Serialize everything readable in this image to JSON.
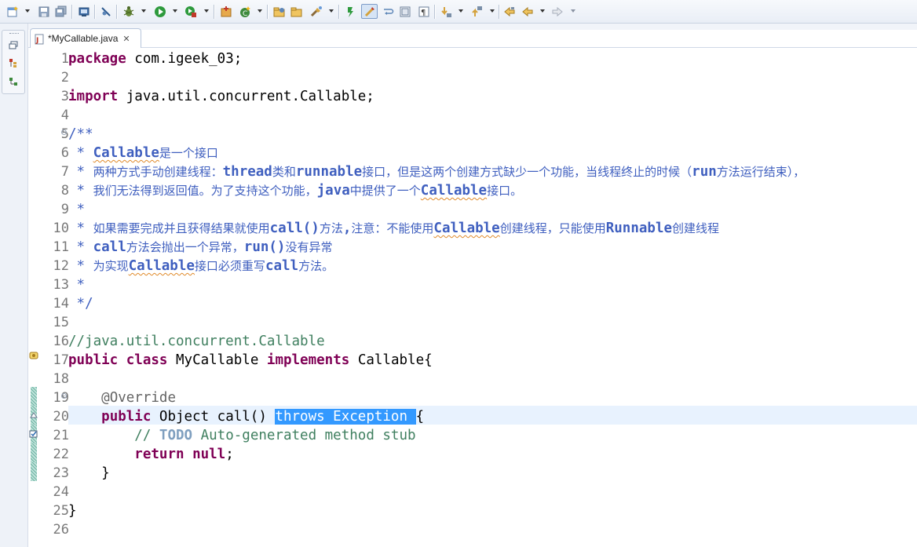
{
  "toolbar": {
    "icons": [
      "new-wizard-icon",
      "save-icon",
      "save-all-icon",
      "print-icon",
      "skip-breakpoints-icon",
      "debug-icon",
      "run-icon",
      "external-tools-icon",
      "new-java-project-icon",
      "new-java-class-icon",
      "open-type-icon",
      "open-task-icon",
      "search-icon",
      "toggle-mark-occurrences-icon",
      "toggle-block-selection-icon",
      "word-wrap-icon",
      "show-whitespace-icon",
      "next-annotation-icon",
      "previous-annotation-icon",
      "last-edit-location-icon",
      "back-icon",
      "forward-icon"
    ]
  },
  "editor_tab": {
    "label": "*MyCallable.java",
    "close_glyph": "✕"
  },
  "code": {
    "line_numbers": [
      "1",
      "2",
      "3",
      "4",
      "5",
      "6",
      "7",
      "8",
      "9",
      "10",
      "11",
      "12",
      "13",
      "14",
      "15",
      "16",
      "17",
      "18",
      "19",
      "20",
      "21",
      "22",
      "23",
      "24",
      "25",
      "26"
    ],
    "l1_kw": "package",
    "l1_rest": " com.igeek_03;",
    "l3_kw": "import",
    "l3_rest": " java.util.concurrent.Callable;",
    "l5": "/**",
    "l6_star": " * ",
    "l6_word": "Callable",
    "l6_cn": "是一个接口",
    "l7_star": " * ",
    "l7_cn1": "两种方式手动创建线程：",
    "l7_w1": "thread",
    "l7_cn2": "类和",
    "l7_w2": "runnable",
    "l7_cn3": "接口，但是这两个创建方式缺少一个功能，当线程终止的时候（",
    "l7_w3": "run",
    "l7_cn4": "方法运行结束），",
    "l8_star": " * ",
    "l8_cn1": "我们无法得到返回值。为了支持这个功能，",
    "l8_w1": "java",
    "l8_cn2": "中提供了一个",
    "l8_w2": "Callable",
    "l8_cn3": "接口。",
    "l9": " *",
    "l10_star": " * ",
    "l10_cn1": "如果需要完成并且获得结果就使用",
    "l10_w1": "call()",
    "l10_cn2": "方法",
    "l10_w2": ",",
    "l10_cn3": "注意：不能使用",
    "l10_w3": "Callable",
    "l10_cn4": "创建线程，只能使用",
    "l10_w4": "Runnable",
    "l10_cn5": "创建线程",
    "l11_star": " * ",
    "l11_w1": "call",
    "l11_cn1": "方法会抛出一个异常，",
    "l11_w2": "run()",
    "l11_cn2": "没有异常",
    "l12_star": " * ",
    "l12_cn1": "为实现",
    "l12_w1": "Callable",
    "l12_cn2": "接口必须重写",
    "l12_w2": "call",
    "l12_cn3": "方法。",
    "l13": " *",
    "l14": " */",
    "l16": "//java.util.concurrent.Callable",
    "l17_kw1": "public",
    "l17_kw2": "class",
    "l17_name": "MyCallable",
    "l17_kw3": "implements",
    "l17_type": "Callable{",
    "l19_anno": "@Override",
    "l20_kw": "public",
    "l20_mid": " Object call() ",
    "l20_sel": "throws Exception ",
    "l20_end": "{",
    "l21_slash": "// ",
    "l21_todo": "TODO",
    "l21_rest": " Auto-generated method stub",
    "l22_kw": "return",
    "l22_kw2": "null",
    "l22_end": ";",
    "l23": "}",
    "l25": "}"
  },
  "colors": {
    "keyword": "#7f0055",
    "javadoc": "#3f5fbf",
    "line_comment": "#3f7f5f",
    "selection": "#3399ff",
    "current_line": "#e8f2fe"
  }
}
